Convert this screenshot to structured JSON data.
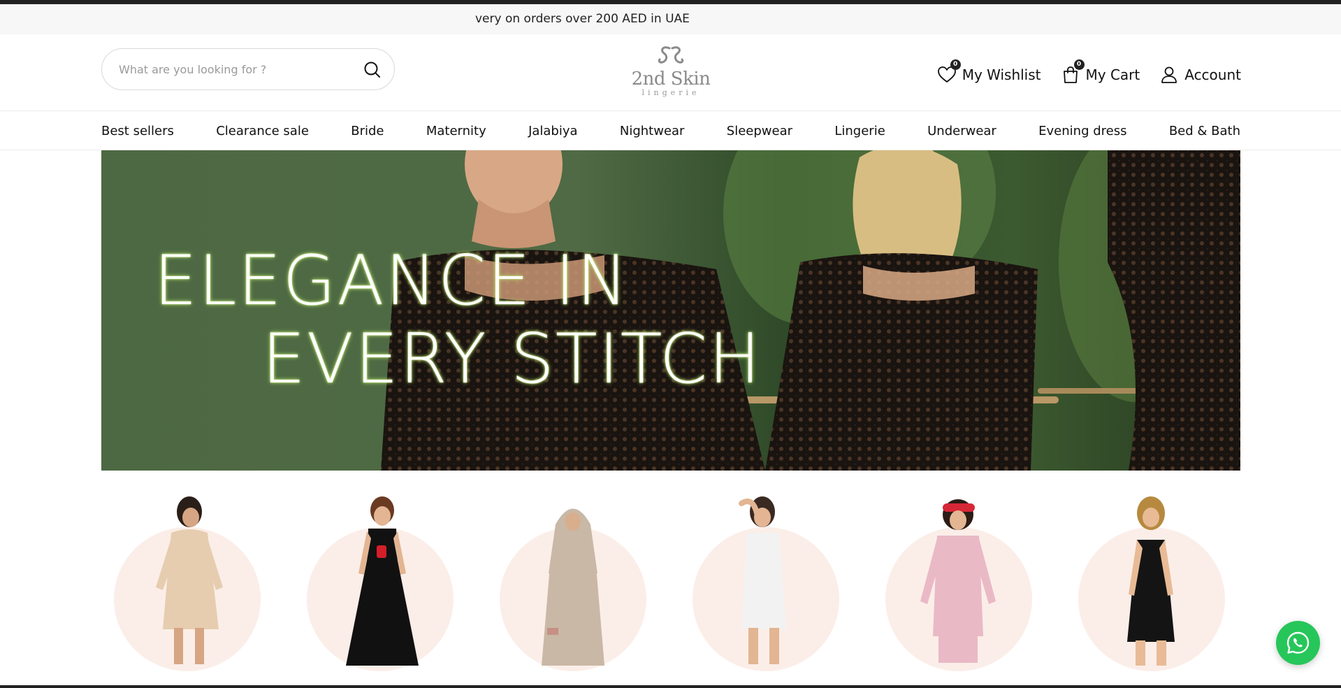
{
  "announcement": {
    "text": "very on orders over 200 AED in UAE"
  },
  "search": {
    "placeholder": "What are you looking for ?"
  },
  "logo": {
    "name": "2nd Skin",
    "tagline": "lingerie"
  },
  "header_actions": {
    "wishlist_label": "My Wishlist",
    "wishlist_count": "0",
    "cart_label": "My Cart",
    "cart_count": "0",
    "account_label": "Account"
  },
  "nav": {
    "items": [
      {
        "label": "Best sellers"
      },
      {
        "label": "Clearance sale"
      },
      {
        "label": "Bride"
      },
      {
        "label": "Maternity"
      },
      {
        "label": "Jalabiya"
      },
      {
        "label": "Nightwear"
      },
      {
        "label": "Sleepwear"
      },
      {
        "label": "Lingerie"
      },
      {
        "label": "Underwear"
      },
      {
        "label": "Evening dress"
      },
      {
        "label": "Bed & Bath"
      }
    ]
  },
  "hero": {
    "line1": "ELEGANCE IN",
    "line2": "EVERY STITCH"
  },
  "categories": {
    "items": [
      {
        "name": "satin-robe",
        "dress_color": "#e6cdb0"
      },
      {
        "name": "black-dress",
        "dress_color": "#111111"
      },
      {
        "name": "jalabiya-hijab",
        "dress_color": "#c9b8a6"
      },
      {
        "name": "white-romper",
        "dress_color": "#f2f2f2"
      },
      {
        "name": "pink-pajama",
        "dress_color": "#eab9c6"
      },
      {
        "name": "black-bodycon",
        "dress_color": "#141414"
      }
    ]
  },
  "colors": {
    "hero_background": "#4d6943",
    "circle_background": "#fbeee8",
    "whatsapp": "#27c65a"
  },
  "icons": {
    "search": "search-icon",
    "wishlist": "heart-icon",
    "cart": "shopping-bag-icon",
    "account": "user-icon",
    "whatsapp": "whatsapp-icon"
  }
}
